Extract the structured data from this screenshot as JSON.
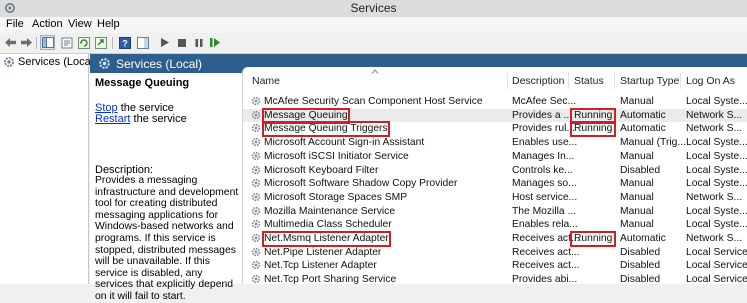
{
  "window": {
    "title": "Services"
  },
  "menu": [
    "File",
    "Action",
    "View",
    "Help"
  ],
  "toolbar": {
    "icons": [
      "back-arrow-icon",
      "forward-arrow-icon",
      "console-tree-icon",
      "properties-icon",
      "refresh-icon",
      "export-list-icon",
      "help-icon",
      "show-pane-icon",
      "start-service-icon",
      "stop-service-icon",
      "pause-service-icon",
      "restart-service-icon"
    ]
  },
  "tree": {
    "root": "Services (Local)"
  },
  "panel": {
    "header": "Services (Local)"
  },
  "description": {
    "title": "Message Queuing",
    "stop_link": "Stop",
    "stop_rest": " the service",
    "restart_link": "Restart",
    "restart_rest": " the service",
    "label": "Description:",
    "text": "Provides a messaging infrastructure and development tool for creating distributed messaging applications for Windows-based networks and programs. If this service is stopped, distributed messages will be unavailable. If this service is disabled, any services that explicitly depend on it will fail to start."
  },
  "table": {
    "columns": [
      "Name",
      "Description",
      "Status",
      "Startup Type",
      "Log On As"
    ],
    "rows": [
      {
        "name": "McAfee Security Scan Component Host Service",
        "description": "McAfee Sec...",
        "status": "",
        "startup": "Manual",
        "logon": "Local Syste..."
      },
      {
        "name": "Message Queuing",
        "description": "Provides a ...",
        "status": "Running",
        "startup": "Automatic",
        "logon": "Network S..."
      },
      {
        "name": "Message Queuing Triggers",
        "description": "Provides rul...",
        "status": "Running",
        "startup": "Automatic",
        "logon": "Network S..."
      },
      {
        "name": "Microsoft Account Sign-in Assistant",
        "description": "Enables use...",
        "status": "",
        "startup": "Manual (Trig...",
        "logon": "Local Syste..."
      },
      {
        "name": "Microsoft iSCSI Initiator Service",
        "description": "Manages In...",
        "status": "",
        "startup": "Manual",
        "logon": "Local Syste..."
      },
      {
        "name": "Microsoft Keyboard Filter",
        "description": "Controls ke...",
        "status": "",
        "startup": "Disabled",
        "logon": "Local Syste..."
      },
      {
        "name": "Microsoft Software Shadow Copy Provider",
        "description": "Manages so...",
        "status": "",
        "startup": "Manual",
        "logon": "Local Syste..."
      },
      {
        "name": "Microsoft Storage Spaces SMP",
        "description": "Host service...",
        "status": "",
        "startup": "Manual",
        "logon": "Network S..."
      },
      {
        "name": "Mozilla Maintenance Service",
        "description": "The Mozilla ...",
        "status": "",
        "startup": "Manual",
        "logon": "Local Syste..."
      },
      {
        "name": "Multimedia Class Scheduler",
        "description": "Enables rela...",
        "status": "",
        "startup": "Manual",
        "logon": "Local Syste..."
      },
      {
        "name": "Net.Msmq Listener Adapter",
        "description": "Receives act...",
        "status": "Running",
        "startup": "Automatic",
        "logon": "Network S..."
      },
      {
        "name": "Net.Pipe Listener Adapter",
        "description": "Receives act...",
        "status": "",
        "startup": "Disabled",
        "logon": "Local Service"
      },
      {
        "name": "Net.Tcp Listener Adapter",
        "description": "Receives act...",
        "status": "",
        "startup": "Disabled",
        "logon": "Local Service"
      },
      {
        "name": "Net.Tcp Port Sharing Service",
        "description": "Provides abi...",
        "status": "",
        "startup": "Disabled",
        "logon": "Local Service"
      }
    ]
  },
  "colors": {
    "header_bg": "#2e5e8e",
    "highlight": "#d21f27",
    "link": "#0033cc"
  }
}
